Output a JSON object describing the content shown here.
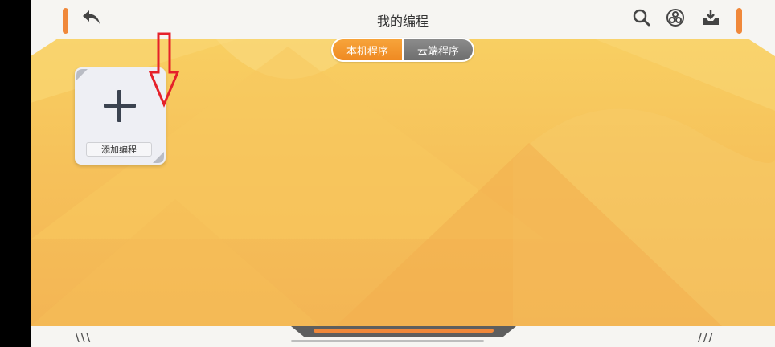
{
  "header": {
    "title": "我的编程",
    "icons": [
      "back-icon",
      "search-icon",
      "community-icon",
      "download-icon"
    ]
  },
  "tabs": [
    {
      "label": "本机程序",
      "active": true
    },
    {
      "label": "云端程序",
      "active": false
    }
  ],
  "card": {
    "label": "添加编程",
    "icon": "plus-icon"
  },
  "annotation": {
    "icon": "red-down-arrow-icon",
    "color": "#e5212a"
  },
  "colors": {
    "accent": "#f0883a",
    "background_top": "#f8cf62",
    "background_bottom": "#f3b554",
    "inactive_tab": "#7d7d7d"
  }
}
